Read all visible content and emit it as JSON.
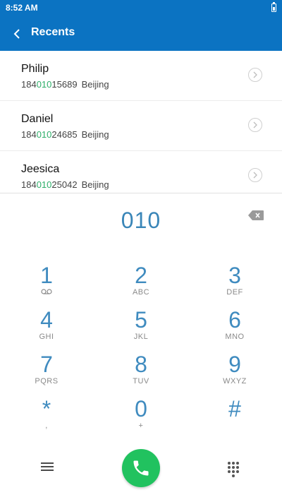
{
  "status": {
    "time": "8:52 AM"
  },
  "header": {
    "title": "Recents"
  },
  "recents": [
    {
      "name": "Philip",
      "prefix": "184",
      "match": "010",
      "suffix": "15689",
      "location": "Beijing"
    },
    {
      "name": "Daniel",
      "prefix": "184",
      "match": "010",
      "suffix": "24685",
      "location": "Beijing"
    },
    {
      "name": "Jeesica",
      "prefix": "184",
      "match": "010",
      "suffix": "25042",
      "location": "Beijing"
    }
  ],
  "dialer": {
    "entered_number": "010"
  },
  "keys": [
    {
      "digit": "1",
      "sub": "ꝏ"
    },
    {
      "digit": "2",
      "sub": "ABC"
    },
    {
      "digit": "3",
      "sub": "DEF"
    },
    {
      "digit": "4",
      "sub": "GHI"
    },
    {
      "digit": "5",
      "sub": "JKL"
    },
    {
      "digit": "6",
      "sub": "MNO"
    },
    {
      "digit": "7",
      "sub": "PQRS"
    },
    {
      "digit": "8",
      "sub": "TUV"
    },
    {
      "digit": "9",
      "sub": "WXYZ"
    },
    {
      "digit": "*",
      "sub": ","
    },
    {
      "digit": "0",
      "sub": "+"
    },
    {
      "digit": "#",
      "sub": ""
    }
  ],
  "colors": {
    "accent": "#0b73c2",
    "call": "#21c25f",
    "match": "#2eaf6a",
    "digits": "#3f8bbf"
  }
}
